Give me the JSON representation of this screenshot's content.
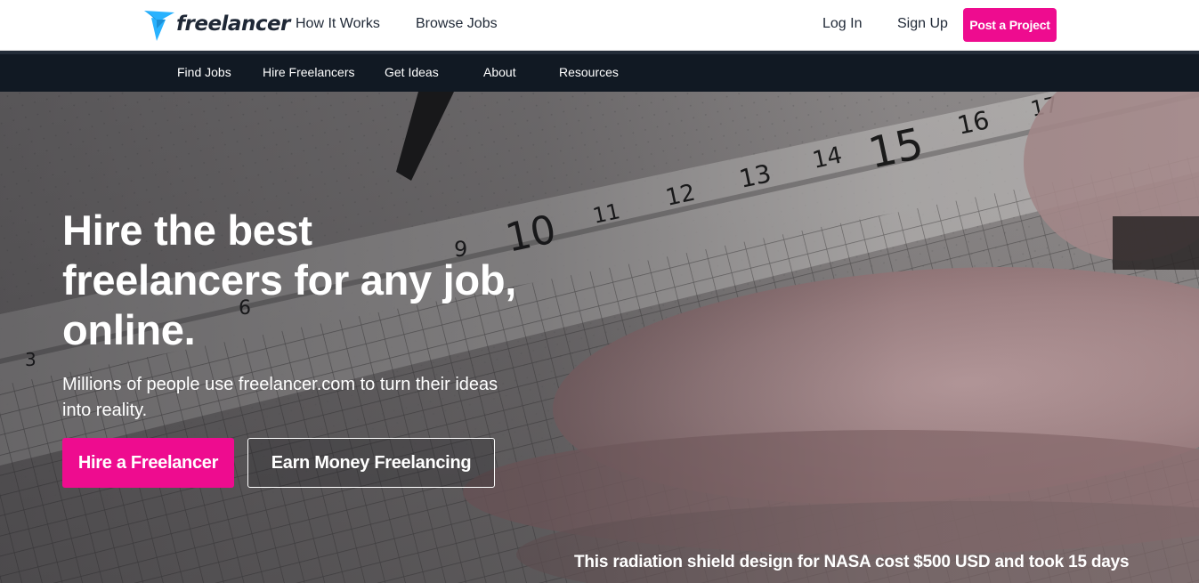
{
  "brand": {
    "name": "freelancer",
    "accent": "#ee0c8f",
    "logo_blue": "#29b2fe",
    "nav_bg": "#111923"
  },
  "header": {
    "links": [
      "How It Works",
      "Browse Jobs"
    ],
    "login": "Log In",
    "signup": "Sign Up",
    "post_project": "Post a Project"
  },
  "subnav": {
    "items": [
      "Find Jobs",
      "Hire Freelancers",
      "Get Ideas",
      "About",
      "Resources"
    ]
  },
  "hero": {
    "title_lines": [
      "Hire the best",
      "freelancers for any job,",
      "online."
    ],
    "subtitle_lines": [
      "Millions of people use freelancer.com to turn their ideas",
      "into reality."
    ],
    "primary_button": "Hire a Freelancer",
    "secondary_button": "Earn Money Freelancing",
    "caption": "This radiation shield design for NASA cost $500 USD and took 15 days",
    "ruler_numbers": [
      "3",
      "6",
      "9",
      "10",
      "11",
      "12",
      "13",
      "14",
      "15",
      "16",
      "17"
    ]
  }
}
